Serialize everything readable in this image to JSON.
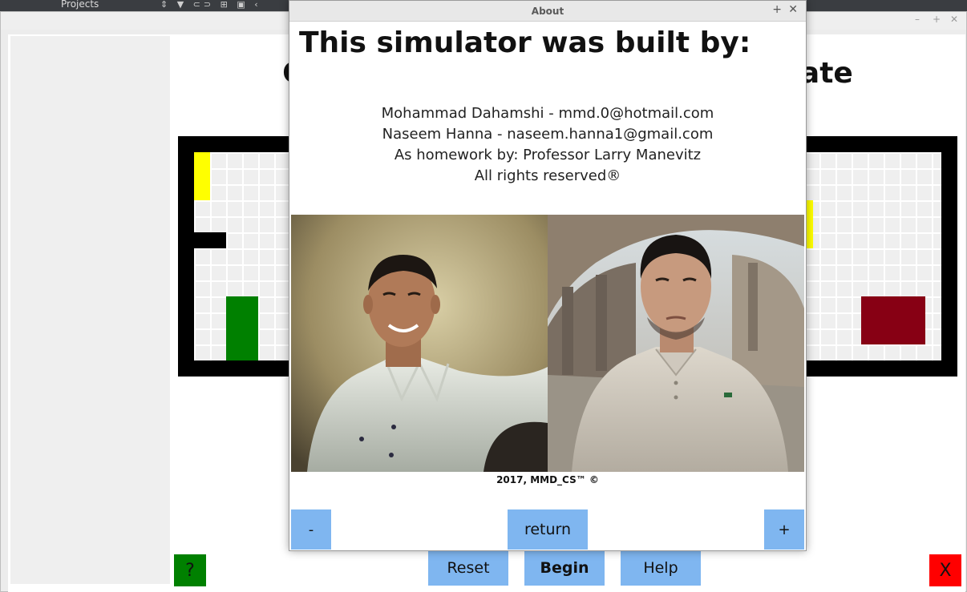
{
  "ide": {
    "projects_label": "Projects",
    "tool_icons": [
      "sort-updown-icon",
      "filter-icon",
      "link-icon",
      "add-column-icon",
      "collapse-icon",
      "back-arrow-icon"
    ]
  },
  "main_window": {
    "controls": [
      "–",
      "+",
      "✕"
    ],
    "title": "Cu                                              tate",
    "board": {
      "colors": {
        "wall": "#000000",
        "start": "#ffff00",
        "agent": "#008000",
        "goal": "#870014"
      }
    },
    "help_button": "?",
    "reset_button": "Reset",
    "begin_button": "Begin",
    "help_label": "Help",
    "exit_button": "X"
  },
  "about_dialog": {
    "title": "About",
    "maximize": "+",
    "close": "✕",
    "heading": "This simulator was built by:",
    "credits": [
      "Mohammad Dahamshi - mmd.0@hotmail.com",
      "Naseem Hanna - naseem.hanna1@gmail.com",
      "As homework by: Professor Larry Manevitz",
      "All rights reserved®"
    ],
    "photos": [
      "photo-mohammad",
      "photo-naseem"
    ],
    "copyright": "2017, MMD_CS™ ©",
    "minus_button": "-",
    "return_button": "return",
    "plus_button": "+"
  }
}
